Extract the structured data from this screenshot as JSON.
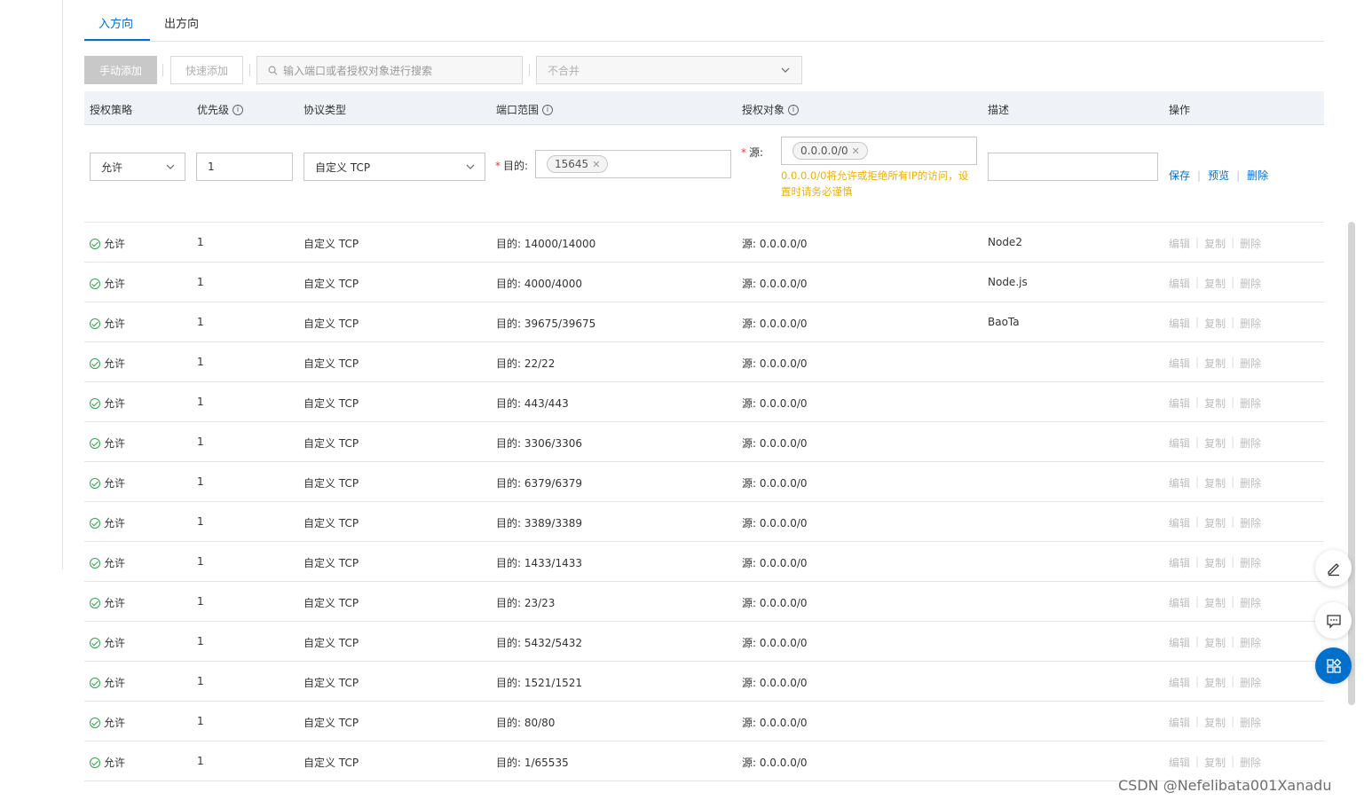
{
  "tabs": [
    {
      "label": "入方向",
      "active": true
    },
    {
      "label": "出方向",
      "active": false
    }
  ],
  "toolbar": {
    "manual_add": "手动添加",
    "quick_add": "快速添加",
    "search_placeholder": "输入端口或者授权对象进行搜索",
    "merge_select": "不合并"
  },
  "table": {
    "headers": {
      "policy": "授权策略",
      "priority": "优先级",
      "protocol": "协议类型",
      "port_range": "端口范围",
      "auth_object": "授权对象",
      "description": "描述",
      "actions": "操作"
    },
    "edit_row": {
      "policy": "允许",
      "priority": "1",
      "protocol": "自定义 TCP",
      "dest_label": "目的:",
      "dest_tag": "15645",
      "source_label": "源:",
      "source_tag": "0.0.0.0/0",
      "warning": "0.0.0.0/0将允许或拒绝所有IP的访问，设置时请务必谨慎",
      "description": "",
      "save": "保存",
      "preview": "预览",
      "delete": "删除"
    },
    "row_actions": {
      "edit": "编辑",
      "copy": "复制",
      "delete": "删除"
    },
    "rows": [
      {
        "policy": "允许",
        "priority": "1",
        "protocol": "自定义 TCP",
        "port": "目的: 14000/14000",
        "auth": "源: 0.0.0.0/0",
        "desc": "Node2"
      },
      {
        "policy": "允许",
        "priority": "1",
        "protocol": "自定义 TCP",
        "port": "目的: 4000/4000",
        "auth": "源: 0.0.0.0/0",
        "desc": "Node.js"
      },
      {
        "policy": "允许",
        "priority": "1",
        "protocol": "自定义 TCP",
        "port": "目的: 39675/39675",
        "auth": "源: 0.0.0.0/0",
        "desc": "BaoTa"
      },
      {
        "policy": "允许",
        "priority": "1",
        "protocol": "自定义 TCP",
        "port": "目的: 22/22",
        "auth": "源: 0.0.0.0/0",
        "desc": ""
      },
      {
        "policy": "允许",
        "priority": "1",
        "protocol": "自定义 TCP",
        "port": "目的: 443/443",
        "auth": "源: 0.0.0.0/0",
        "desc": ""
      },
      {
        "policy": "允许",
        "priority": "1",
        "protocol": "自定义 TCP",
        "port": "目的: 3306/3306",
        "auth": "源: 0.0.0.0/0",
        "desc": ""
      },
      {
        "policy": "允许",
        "priority": "1",
        "protocol": "自定义 TCP",
        "port": "目的: 6379/6379",
        "auth": "源: 0.0.0.0/0",
        "desc": ""
      },
      {
        "policy": "允许",
        "priority": "1",
        "protocol": "自定义 TCP",
        "port": "目的: 3389/3389",
        "auth": "源: 0.0.0.0/0",
        "desc": ""
      },
      {
        "policy": "允许",
        "priority": "1",
        "protocol": "自定义 TCP",
        "port": "目的: 1433/1433",
        "auth": "源: 0.0.0.0/0",
        "desc": ""
      },
      {
        "policy": "允许",
        "priority": "1",
        "protocol": "自定义 TCP",
        "port": "目的: 23/23",
        "auth": "源: 0.0.0.0/0",
        "desc": ""
      },
      {
        "policy": "允许",
        "priority": "1",
        "protocol": "自定义 TCP",
        "port": "目的: 5432/5432",
        "auth": "源: 0.0.0.0/0",
        "desc": ""
      },
      {
        "policy": "允许",
        "priority": "1",
        "protocol": "自定义 TCP",
        "port": "目的: 1521/1521",
        "auth": "源: 0.0.0.0/0",
        "desc": ""
      },
      {
        "policy": "允许",
        "priority": "1",
        "protocol": "自定义 TCP",
        "port": "目的: 80/80",
        "auth": "源: 0.0.0.0/0",
        "desc": ""
      },
      {
        "policy": "允许",
        "priority": "1",
        "protocol": "自定义 TCP",
        "port": "目的: 1/65535",
        "auth": "源: 0.0.0.0/0",
        "desc": ""
      }
    ]
  },
  "floating": {
    "icons": [
      "edit-icon",
      "feedback-icon",
      "apps-icon"
    ]
  },
  "watermark": "CSDN @Nefelibata001Xanadu",
  "colors": {
    "accent": "#0070cc",
    "allow": "#33a24f",
    "warning": "#f0b000",
    "required": "#e03b3b"
  }
}
